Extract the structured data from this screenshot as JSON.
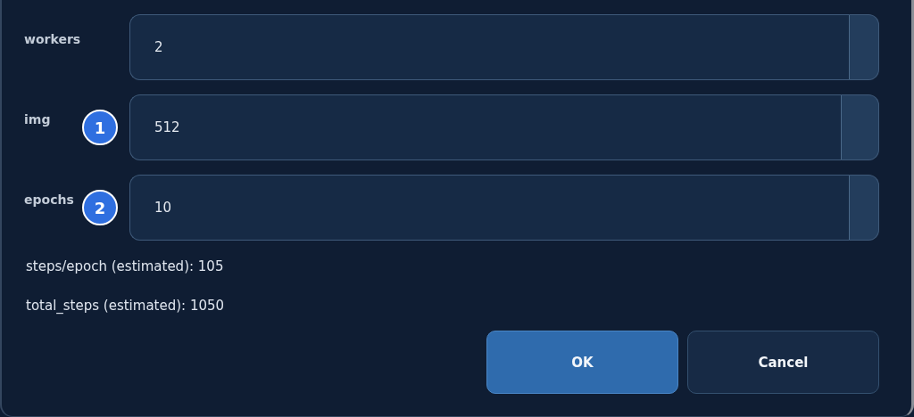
{
  "fields": [
    {
      "label": "workers",
      "value": "2"
    },
    {
      "label": "img",
      "value": "512",
      "badge": "1"
    },
    {
      "label": "epochs",
      "value": "10",
      "badge": "2"
    }
  ],
  "info": [
    "steps/epoch (estimated): 105",
    "total_steps (estimated): 1050"
  ],
  "buttons": [
    {
      "label": "OK",
      "kind": "primary"
    },
    {
      "label": "Cancel",
      "kind": "secondary"
    }
  ]
}
